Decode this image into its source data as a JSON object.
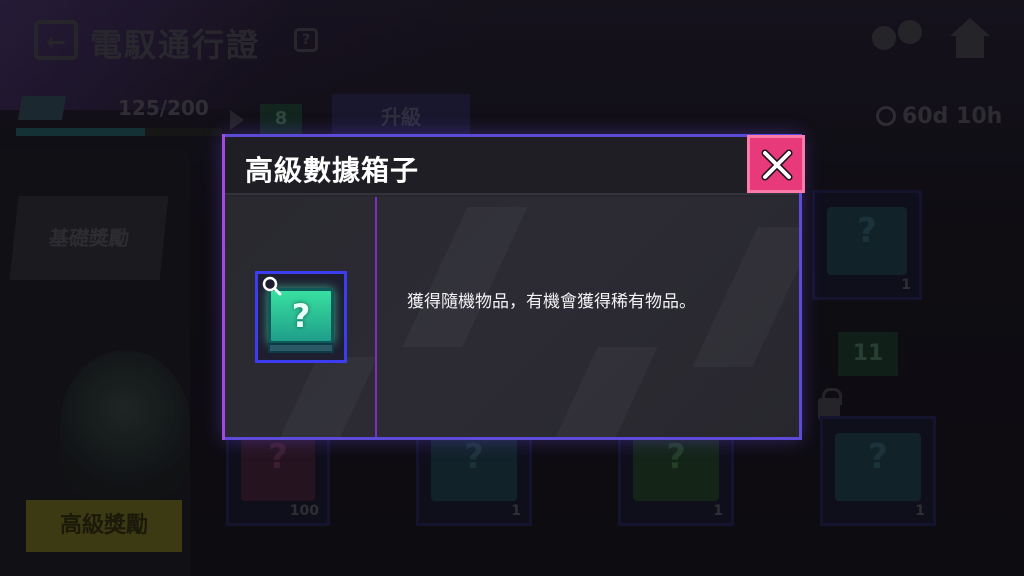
{
  "background": {
    "screen_title": "電馭通行證",
    "help_glyph": "?",
    "xp": {
      "text": "125/200",
      "fraction": 0.625
    },
    "current_level": "8",
    "upgrade_label": "升級",
    "timer": "60d 10h",
    "basic_reward_label": "基礎獎勵",
    "premium_reward_label": "高級獎勵",
    "next_level": "11",
    "crates": [
      {
        "q": "?",
        "count": "1"
      },
      {
        "q": "?",
        "count": "100"
      },
      {
        "q": "?",
        "count": "1"
      },
      {
        "q": "?",
        "count": "1"
      },
      {
        "q": "?",
        "count": "1"
      }
    ]
  },
  "modal": {
    "title": "高級數據箱子",
    "close_label": "✕",
    "item_glyph": "?",
    "description": "獲得隨機物品，有機會獲得稀有物品。"
  },
  "colors": {
    "modal_border": "#5b4bd6",
    "close_button": "#e8397a",
    "divider": "#7a2fc0",
    "item_frame": "#3d3df0"
  },
  "icons": [
    "back-arrow-icon",
    "help-icon",
    "friends-icon",
    "home-icon",
    "clock-icon",
    "lock-icon",
    "close-icon",
    "magnifier-icon"
  ]
}
